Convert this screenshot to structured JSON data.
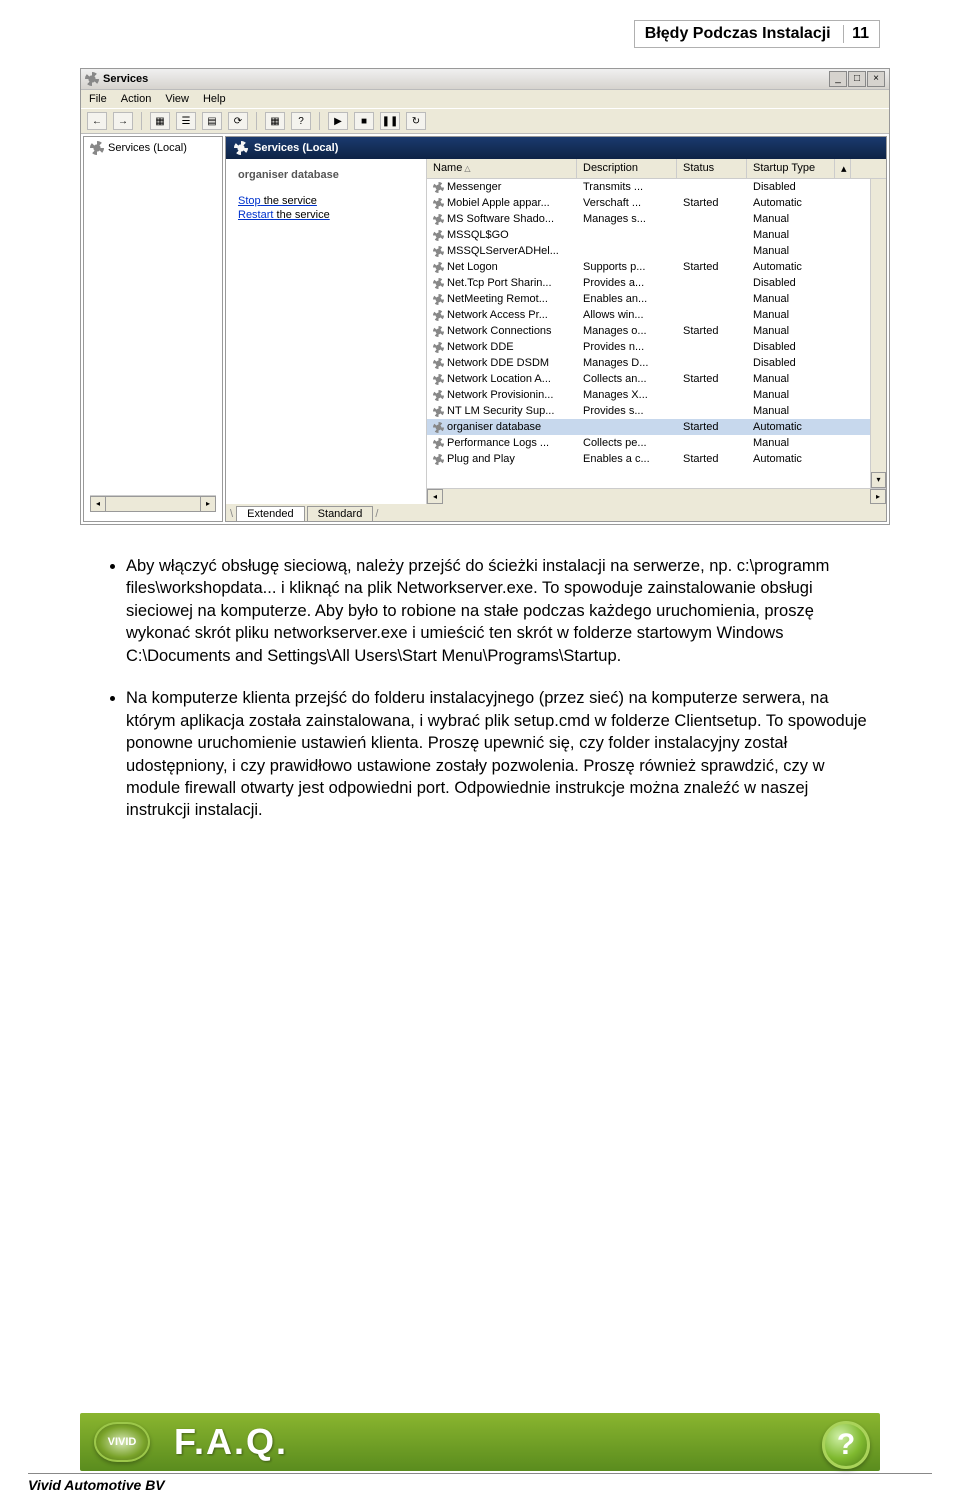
{
  "header": {
    "title": "Błędy Podczas Instalacji",
    "page_num": "11"
  },
  "win": {
    "title": "Services",
    "menu": [
      "File",
      "Action",
      "View",
      "Help"
    ],
    "left_panel_label": "Services (Local)",
    "right_header": "Services (Local)",
    "detail": {
      "name": "organiser database",
      "link_stop": "Stop",
      "link_stop_after": " the service",
      "link_restart": "Restart",
      "link_restart_after": " the service"
    },
    "cols": {
      "name": "Name",
      "desc": "Description",
      "status": "Status",
      "startup": "Startup Type"
    },
    "rows": [
      {
        "name": "Messenger",
        "desc": "Transmits ...",
        "status": "",
        "startup": "Disabled"
      },
      {
        "name": "Mobiel Apple appar...",
        "desc": "Verschaft ...",
        "status": "Started",
        "startup": "Automatic"
      },
      {
        "name": "MS Software Shado...",
        "desc": "Manages s...",
        "status": "",
        "startup": "Manual"
      },
      {
        "name": "MSSQL$GO",
        "desc": "",
        "status": "",
        "startup": "Manual"
      },
      {
        "name": "MSSQLServerADHel...",
        "desc": "",
        "status": "",
        "startup": "Manual"
      },
      {
        "name": "Net Logon",
        "desc": "Supports p...",
        "status": "Started",
        "startup": "Automatic"
      },
      {
        "name": "Net.Tcp Port Sharin...",
        "desc": "Provides a...",
        "status": "",
        "startup": "Disabled"
      },
      {
        "name": "NetMeeting Remot...",
        "desc": "Enables an...",
        "status": "",
        "startup": "Manual"
      },
      {
        "name": "Network Access Pr...",
        "desc": "Allows win...",
        "status": "",
        "startup": "Manual"
      },
      {
        "name": "Network Connections",
        "desc": "Manages o...",
        "status": "Started",
        "startup": "Manual"
      },
      {
        "name": "Network DDE",
        "desc": "Provides n...",
        "status": "",
        "startup": "Disabled"
      },
      {
        "name": "Network DDE DSDM",
        "desc": "Manages D...",
        "status": "",
        "startup": "Disabled"
      },
      {
        "name": "Network Location A...",
        "desc": "Collects an...",
        "status": "Started",
        "startup": "Manual"
      },
      {
        "name": "Network Provisionin...",
        "desc": "Manages X...",
        "status": "",
        "startup": "Manual"
      },
      {
        "name": "NT LM Security Sup...",
        "desc": "Provides s...",
        "status": "",
        "startup": "Manual"
      },
      {
        "name": "organiser database",
        "desc": "",
        "status": "Started",
        "startup": "Automatic",
        "selected": true
      },
      {
        "name": "Performance Logs ...",
        "desc": "Collects pe...",
        "status": "",
        "startup": "Manual"
      },
      {
        "name": "Plug and Play",
        "desc": "Enables a c...",
        "status": "Started",
        "startup": "Automatic"
      }
    ],
    "tabs": {
      "extended": "Extended",
      "standard": "Standard"
    }
  },
  "bullets": {
    "p1": "Aby włączyć obsługę sieciową, należy przejść do ścieżki instalacji na serwerze, np. c:\\programm files\\workshopdata... i kliknąć na plik Networkserver.exe. To spowoduje zainstalowanie obsługi sieciowej na komputerze. Aby było to robione na stałe podczas każdego uruchomienia, proszę wykonać skrót pliku networkserver.exe i umieścić ten skrót w folderze startowym Windows C:\\Documents and Settings\\All Users\\Start Menu\\Programs\\Startup.",
    "p2": "Na komputerze klienta przejść do folderu instalacyjnego (przez sieć) na komputerze serwera, na którym aplikacja została zainstalowana, i wybrać plik setup.cmd w folderze Clientsetup. To spowoduje ponowne uruchomienie ustawień klienta. Proszę upewnić się, czy folder instalacyjny został udostępniony, i czy prawidłowo ustawione zostały pozwolenia. Proszę również sprawdzić, czy w module firewall otwarty jest odpowiedni port. Odpowiednie instrukcje można znaleźć w naszej instrukcji instalacji."
  },
  "footer": {
    "vivid": "VIVID",
    "faq": "F.A.Q.",
    "help": "?",
    "company": "Vivid Automotive BV"
  }
}
